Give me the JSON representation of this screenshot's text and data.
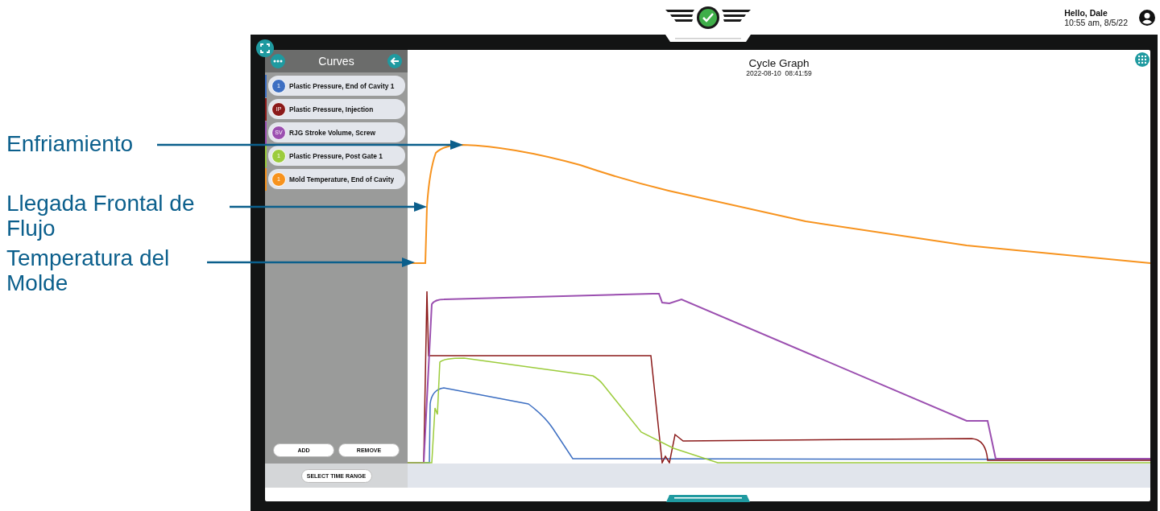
{
  "annotations": [
    {
      "text": "Enfriamiento"
    },
    {
      "text": "Llegada Frontal de Flujo"
    },
    {
      "text": "Temperatura del Molde"
    }
  ],
  "header": {
    "greeting": "Hello, Dale",
    "timestamp": "10:55 am, 8/5/22"
  },
  "sidebar": {
    "title": "Curves",
    "curves": [
      {
        "badge": "1",
        "label": "Plastic Pressure, End of Cavity 1",
        "color": "#3d6fc2"
      },
      {
        "badge": "IP",
        "label": "Plastic Pressure, Injection",
        "color": "#8b1a1a"
      },
      {
        "badge": "SV",
        "label": "RJG Stroke Volume, Screw",
        "color": "#9b4fb0"
      },
      {
        "badge": "1",
        "label": "Plastic Pressure, Post Gate 1",
        "color": "#9ccc3c"
      },
      {
        "badge": "1",
        "label": "Mold Temperature, End of Cavity",
        "color": "#f7931e"
      }
    ],
    "buttons": [
      "ADD",
      "REMOVE"
    ],
    "time_range_button": "SELECT TIME RANGE"
  },
  "graph": {
    "title": "Cycle Graph",
    "timestamp": "2022-08-10  08:41:59"
  }
}
